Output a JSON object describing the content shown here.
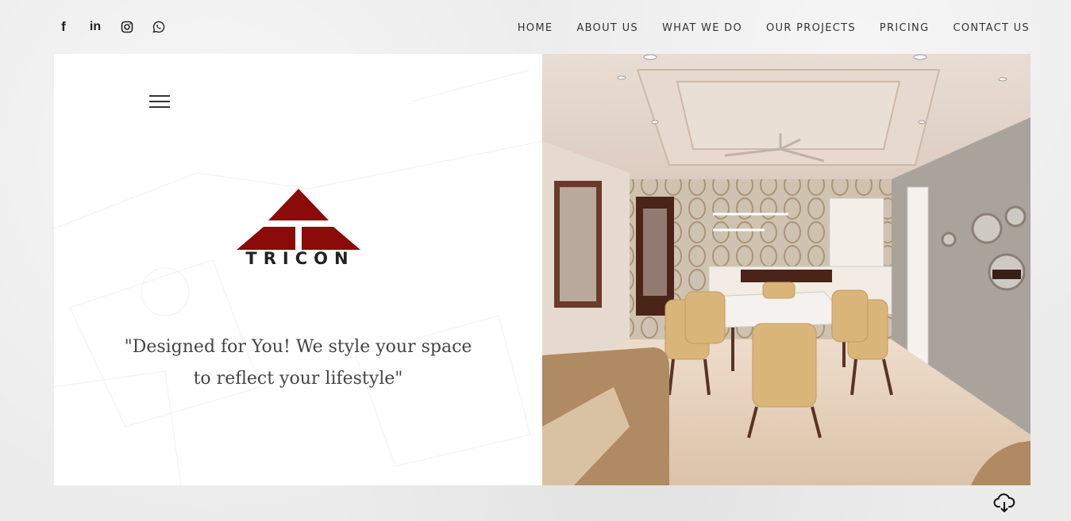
{
  "social": [
    {
      "name": "facebook-icon",
      "glyph": "f"
    },
    {
      "name": "linkedin-icon",
      "glyph": "in"
    },
    {
      "name": "instagram-icon",
      "glyph": ""
    },
    {
      "name": "whatsapp-icon",
      "glyph": ""
    }
  ],
  "nav": {
    "items": [
      "HOME",
      "ABOUT US",
      "WHAT WE DO",
      "OUR PROJECTS",
      "PRICING",
      "CONTACT US"
    ]
  },
  "brand": {
    "name": "TRICON",
    "color": "#8b0a0a"
  },
  "tagline": {
    "line1": "\"Designed for You! We style your space",
    "line2": "to reflect your lifestyle\""
  },
  "icons": {
    "menu": "hamburger-menu-icon",
    "download": "cloud-download-icon"
  }
}
